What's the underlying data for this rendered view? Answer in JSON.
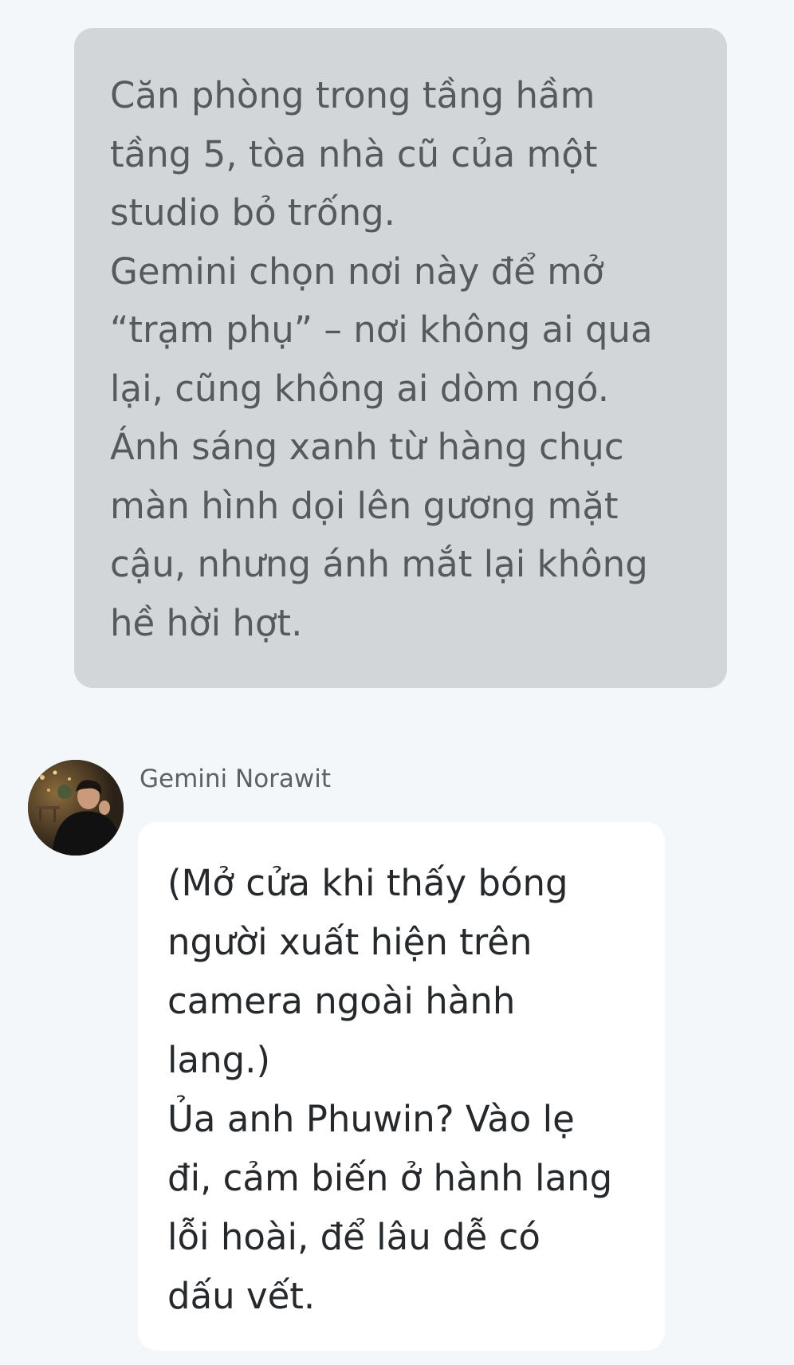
{
  "narration": {
    "lines": [
      "Căn phòng trong tầng hầm",
      "tầng 5, tòa nhà cũ của một",
      "studio bỏ trống.",
      "Gemini chọn nơi này để mở",
      "“trạm phụ” – nơi không ai qua",
      "lại, cũng không ai dòm ngó.",
      "Ánh sáng xanh từ hàng chục",
      "màn hình dọi lên gương mặt",
      "cậu, nhưng ánh mắt lại không",
      "hề hời hợt."
    ]
  },
  "message": {
    "sender": "Gemini Norawit",
    "lines": [
      "(Mở cửa khi thấy bóng",
      "người xuất hiện trên",
      "camera ngoài hành",
      "lang.)",
      "Ủa anh Phuwin? Vào lẹ",
      "đi, cảm biến ở hành lang",
      "lỗi hoài, để lâu dễ có",
      "dấu vết."
    ]
  },
  "colors": {
    "background": "#f4f7f9",
    "narration_bubble": "#d3d6d8",
    "narration_text": "#555a5f",
    "reply_bubble": "#ffffff",
    "reply_text": "#26292c",
    "sender_name": "#5c6166"
  }
}
